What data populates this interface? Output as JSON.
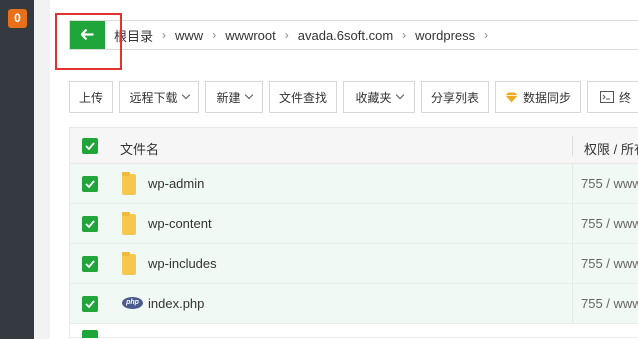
{
  "sidebar": {
    "badge_count": "0"
  },
  "pathbar": {
    "crumbs": [
      "根目录",
      "www",
      "wwwroot",
      "avada.6soft.com",
      "wordpress"
    ],
    "separator": "›"
  },
  "toolbar": {
    "upload": "上传",
    "remote_download": "远程下载",
    "new": "新建",
    "file_search": "文件查找",
    "favorites": "收藏夹",
    "share_list": "分享列表",
    "data_sync": "数据同步",
    "terminal": "终"
  },
  "table": {
    "header_name": "文件名",
    "header_perm": "权限 / 所有者",
    "rows": [
      {
        "name": "wp-admin",
        "perm": "755 / www",
        "icon": "folder-icon"
      },
      {
        "name": "wp-content",
        "perm": "755 / www",
        "icon": "folder-icon"
      },
      {
        "name": "wp-includes",
        "perm": "755 / www",
        "icon": "folder-icon"
      },
      {
        "name": "index.php",
        "perm": "755 / www",
        "icon": "php-file-icon"
      }
    ]
  },
  "colors": {
    "accent": "#20a53a",
    "sidebar": "#343a40",
    "badge": "#e8701a",
    "highlight": "#e23232"
  }
}
